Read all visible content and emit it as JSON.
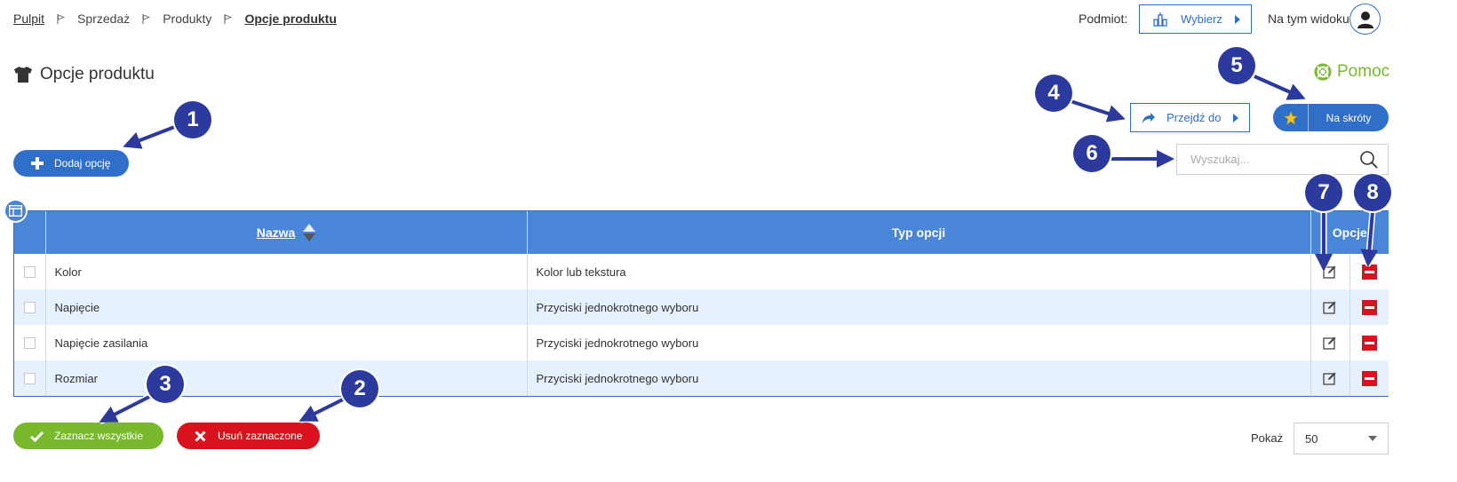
{
  "breadcrumb": {
    "items": [
      {
        "label": "Pulpit"
      },
      {
        "label": "Sprzedaż"
      },
      {
        "label": "Produkty"
      },
      {
        "label": "Opcje produktu"
      }
    ]
  },
  "header": {
    "subject_label": "Podmiot:",
    "subject_button": "Wybierz",
    "view_label": "Na tym widoku",
    "help_label": "Pomoc"
  },
  "page": {
    "title": "Opcje produktu",
    "title_icon": "tshirt-icon"
  },
  "toolbar": {
    "add_label": "Dodaj opcję",
    "goto_label": "Przejdź do",
    "shortcut_label": "Na skróty",
    "search_placeholder": "Wyszukaj..."
  },
  "table": {
    "columns": {
      "name": "Nazwa",
      "type": "Typ opcji",
      "options": "Opcje"
    },
    "sort": "ascending",
    "rows": [
      {
        "name": "Kolor",
        "type": "Kolor lub tekstura"
      },
      {
        "name": "Napięcie",
        "type": "Przyciski jednokrotnego wyboru"
      },
      {
        "name": "Napięcie zasilania",
        "type": "Przyciski jednokrotnego wyboru"
      },
      {
        "name": "Rozmiar",
        "type": "Przyciski jednokrotnego wyboru"
      }
    ]
  },
  "footer": {
    "select_all_label": "Zaznacz wszystkie",
    "delete_selected_label": "Usuń zaznaczone",
    "show_label": "Pokaż",
    "page_size": "50"
  },
  "annotations": [
    "1",
    "2",
    "3",
    "4",
    "5",
    "6",
    "7",
    "8"
  ],
  "colors": {
    "primary": "#2f6fc9",
    "header_bg": "#4a86d8",
    "success": "#7ab82e",
    "danger": "#d8131d",
    "annotation": "#2b3a9c",
    "row_alt": "#e6f1fd"
  }
}
